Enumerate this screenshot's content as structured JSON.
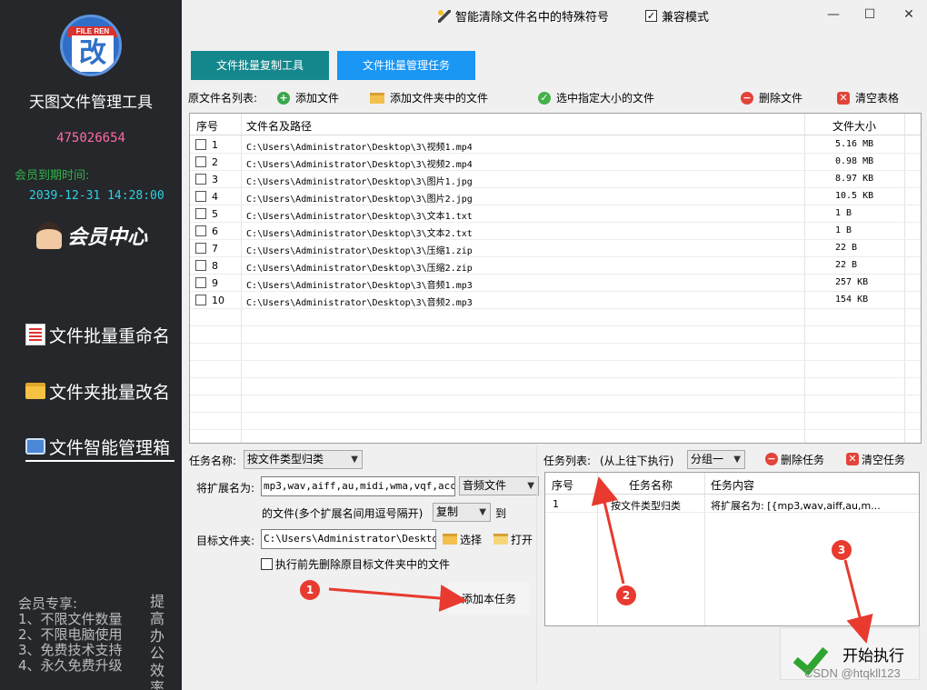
{
  "sidebar": {
    "logo_text": "FILE REN",
    "logo_glyph": "改",
    "app_title": "天图文件管理工具",
    "account": "475026654",
    "expire_label": "会员到期时间:",
    "expire_value": "2039-12-31 14:28:00",
    "member_center": "会员中心",
    "nav": [
      {
        "label": "文件批量重命名",
        "icon": "document-icon"
      },
      {
        "label": "文件夹批量改名",
        "icon": "folder-icon"
      },
      {
        "label": "文件智能管理箱",
        "icon": "toolbox-icon"
      }
    ],
    "promo_lines": [
      "会员专享:",
      "1、不限文件数量",
      "2、不限电脑使用",
      "3、免费技术支持",
      "4、永久免费升级"
    ],
    "promo_side": "提高办公效率"
  },
  "titlebar": {
    "special_chars": "智能清除文件名中的特殊符号",
    "compat_mode": "兼容模式",
    "compat_checked": "✓",
    "minimize": "—",
    "maximize": "☐",
    "close": "✕"
  },
  "tabs": {
    "copy": "文件批量复制工具",
    "manage": "文件批量管理任务"
  },
  "toolbar": {
    "list_label": "原文件名列表:",
    "add_file": "添加文件",
    "add_folder": "添加文件夹中的文件",
    "select_size": "选中指定大小的文件",
    "delete_file": "删除文件",
    "clear_table": "清空表格"
  },
  "file_table": {
    "headers": {
      "index": "序号",
      "path": "文件名及路径",
      "size": "文件大小"
    },
    "rows": [
      {
        "index": "1",
        "path": "C:\\Users\\Administrator\\Desktop\\3\\视频1.mp4",
        "size": "5.16 MB"
      },
      {
        "index": "2",
        "path": "C:\\Users\\Administrator\\Desktop\\3\\视频2.mp4",
        "size": "0.98 MB"
      },
      {
        "index": "3",
        "path": "C:\\Users\\Administrator\\Desktop\\3\\图片1.jpg",
        "size": "8.97 KB"
      },
      {
        "index": "4",
        "path": "C:\\Users\\Administrator\\Desktop\\3\\图片2.jpg",
        "size": "10.5 KB"
      },
      {
        "index": "5",
        "path": "C:\\Users\\Administrator\\Desktop\\3\\文本1.txt",
        "size": "1 B"
      },
      {
        "index": "6",
        "path": "C:\\Users\\Administrator\\Desktop\\3\\文本2.txt",
        "size": "1 B"
      },
      {
        "index": "7",
        "path": "C:\\Users\\Administrator\\Desktop\\3\\压缩1.zip",
        "size": "22 B"
      },
      {
        "index": "8",
        "path": "C:\\Users\\Administrator\\Desktop\\3\\压缩2.zip",
        "size": "22 B"
      },
      {
        "index": "9",
        "path": "C:\\Users\\Administrator\\Desktop\\3\\音频1.mp3",
        "size": "257 KB"
      },
      {
        "index": "10",
        "path": "C:\\Users\\Administrator\\Desktop\\3\\音频2.mp3",
        "size": "154 KB"
      }
    ]
  },
  "task_form": {
    "task_name_label": "任务名称:",
    "task_name_value": "按文件类型归类",
    "ext_label": "将扩展名为:",
    "ext_value": "mp3,wav,aiff,au,midi,wma,vqf,acc,ap",
    "ext_type": "音频文件",
    "files_note": "的文件(多个扩展名间用逗号隔开)",
    "action": "复制",
    "to": "到",
    "target_label": "目标文件夹:",
    "target_value": "C:\\Users\\Administrator\\Desktop\\",
    "choose": "选择",
    "open": "打开",
    "delete_first": "执行前先删除原目标文件夹中的文件",
    "add_task": "添加本任务"
  },
  "task_list": {
    "label": "任务列表:",
    "order_note": "(从上往下执行)",
    "group": "分组一",
    "delete_task": "删除任务",
    "clear_tasks": "清空任务",
    "headers": {
      "index": "序号",
      "name": "任务名称",
      "content": "任务内容"
    },
    "rows": [
      {
        "index": "1",
        "name": "按文件类型归类",
        "content": "将扩展名为: [{mp3,wav,aiff,au,m..."
      }
    ]
  },
  "start_button": "开始执行",
  "markers": [
    "1",
    "2",
    "3"
  ],
  "watermark": "CSDN @htqkll123",
  "colors": {
    "sidebar_bg": "#25272b",
    "tab_copy": "#14878c",
    "tab_manage": "#1a96f5",
    "annotation_red": "#e83a2f",
    "start_check": "#2ea530"
  }
}
